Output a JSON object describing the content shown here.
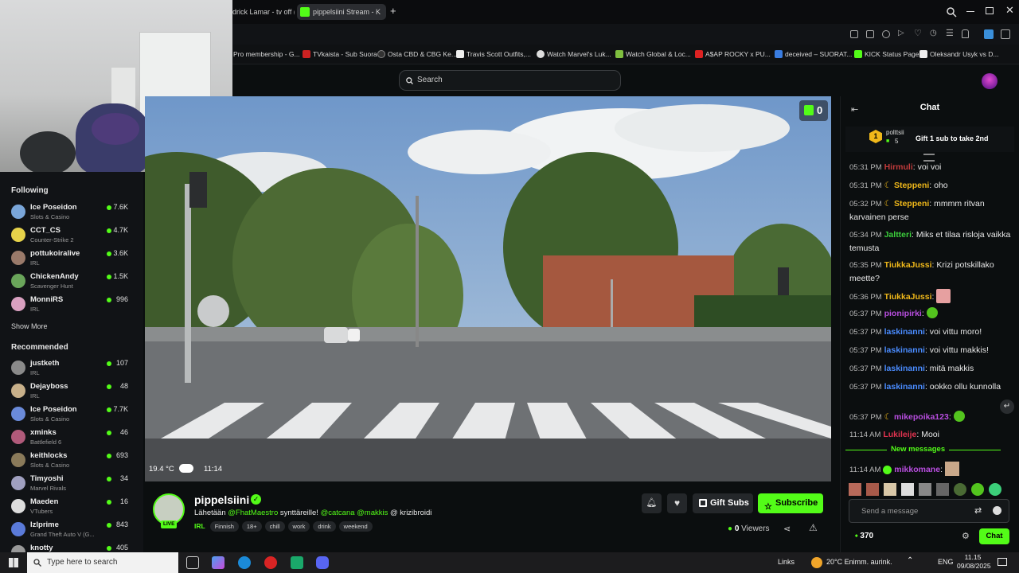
{
  "browser": {
    "tabs": [
      {
        "label": "drick Lamar - tv off (C"
      },
      {
        "label": "pippelsiini Stream - K"
      }
    ],
    "new_tab": "+",
    "bookmarks": [
      {
        "label": "Pro membership - G..."
      },
      {
        "label": "TVkaista - Sub Suora"
      },
      {
        "label": "Osta CBD & CBG Ke..."
      },
      {
        "label": "Travis Scott Outfits,..."
      },
      {
        "label": "Watch Marvel's Luk..."
      },
      {
        "label": "Watch Global & Loc..."
      },
      {
        "label": "A$AP ROCKY x PU..."
      },
      {
        "label": "deceived – SUORAT..."
      },
      {
        "label": "KICK Status Page"
      },
      {
        "label": "Oleksandr Usyk vs D..."
      }
    ]
  },
  "search": {
    "placeholder": "Search"
  },
  "sidebar": {
    "following_title": "Following",
    "following": [
      {
        "name": "Ice Poseidon",
        "category": "Slots & Casino",
        "viewers": "7.6K"
      },
      {
        "name": "CCT_CS",
        "category": "Counter-Strike 2",
        "viewers": "4.7K"
      },
      {
        "name": "pottukoiralive",
        "category": "IRL",
        "viewers": "3.6K"
      },
      {
        "name": "ChickenAndy",
        "category": "Scavenger Hunt",
        "viewers": "1.5K"
      },
      {
        "name": "MonniRS",
        "category": "IRL",
        "viewers": "996"
      }
    ],
    "show_more": "Show More",
    "recommended_title": "Recommended",
    "recommended": [
      {
        "name": "justketh",
        "category": "IRL",
        "viewers": "107"
      },
      {
        "name": "Dejayboss",
        "category": "IRL",
        "viewers": "48"
      },
      {
        "name": "Ice Poseidon",
        "category": "Slots & Casino",
        "viewers": "7.7K"
      },
      {
        "name": "xminks",
        "category": "Battlefield 6",
        "viewers": "46"
      },
      {
        "name": "keithlocks",
        "category": "Slots & Casino",
        "viewers": "693"
      },
      {
        "name": "Timyoshi",
        "category": "Marvel Rivals",
        "viewers": "34"
      },
      {
        "name": "Maeden",
        "category": "VTubers",
        "viewers": "16"
      },
      {
        "name": "Izlprime",
        "category": "Grand Theft Auto V (G...",
        "viewers": "843"
      },
      {
        "name": "knotty",
        "category": "",
        "viewers": "405"
      }
    ]
  },
  "video": {
    "badge_count": "0",
    "temperature": "19.4 °C",
    "clock": "11:14"
  },
  "stream": {
    "streamer": "pippelsiini",
    "live_badge": "LIVE",
    "title_prefix": "Lähetään",
    "mention1": "@FhatMaestro",
    "title_mid": "synttäreille!",
    "mention2": "@catcana",
    "mention3": "@makkis",
    "title_suffix": "@ krizibroidi",
    "category": "IRL",
    "tags": [
      "Finnish",
      "18+",
      "chill",
      "work",
      "drink",
      "weekend"
    ],
    "gift_subs": "Gift Subs",
    "subscribe": "Subscribe",
    "viewers_count": "0",
    "viewers_label": "Viewers"
  },
  "chat": {
    "title": "Chat",
    "pinned_user": "polttsii",
    "pinned_count": "5",
    "pinned_rank": "1",
    "pinned_text": "Gift 1 sub to take 2nd",
    "messages": [
      {
        "time": "05:31 PM",
        "user": "Hirmuli",
        "text": "voi voi",
        "color": "#c13b3b"
      },
      {
        "time": "05:31 PM",
        "user": "Steppeni",
        "text": "oho",
        "color": "#f0b81a"
      },
      {
        "time": "05:32 PM",
        "user": "Steppeni",
        "text": "mmmm ritvan karvainen perse",
        "color": "#f0b81a"
      },
      {
        "time": "05:34 PM",
        "user": "Jaltteri",
        "text": "Miks et tilaa risloja vaikka temusta",
        "color": "#3ccf3c"
      },
      {
        "time": "05:35 PM",
        "user": "TiukkaJussi",
        "text": "Krizi potskillako meette?",
        "color": "#f0b81a"
      },
      {
        "time": "05:36 PM",
        "user": "TiukkaJussi",
        "text": "",
        "color": "#f0b81a"
      },
      {
        "time": "05:37 PM",
        "user": "pionipirki",
        "text": "",
        "color": "#b94ee0"
      },
      {
        "time": "05:37 PM",
        "user": "laskinanni",
        "text": "voi vittu moro!",
        "color": "#4a8cff"
      },
      {
        "time": "05:37 PM",
        "user": "laskinanni",
        "text": "voi vittu makkis!",
        "color": "#4a8cff"
      },
      {
        "time": "05:37 PM",
        "user": "laskinanni",
        "text": "mitä makkis",
        "color": "#4a8cff"
      },
      {
        "time": "05:37 PM",
        "user": "laskinanni",
        "text": "ookko ollu kunnolla",
        "color": "#4a8cff"
      },
      {
        "time": "05:37 PM",
        "user": "mikepoika123",
        "text": "",
        "color": "#b94ee0"
      },
      {
        "time": "11:14 AM",
        "user": "Lukileije",
        "text": "Mooi",
        "color": "#e0334f"
      }
    ],
    "new_messages": "New messages",
    "last_message": {
      "time": "11:14 AM",
      "user": "mikkomane",
      "text": "",
      "color": "#b94ee0"
    },
    "input_placeholder": "Send a message",
    "points": "370",
    "send_label": "Chat"
  },
  "taskbar": {
    "search_placeholder": "Type here to search",
    "links": "Links",
    "weather": "20°C Enimm. aurink.",
    "language": "ENG",
    "time": "11.15",
    "date": "09/08/2025"
  },
  "colors": {
    "accent": "#53fc18",
    "background": "#0b0e0f",
    "panel": "#111316"
  }
}
